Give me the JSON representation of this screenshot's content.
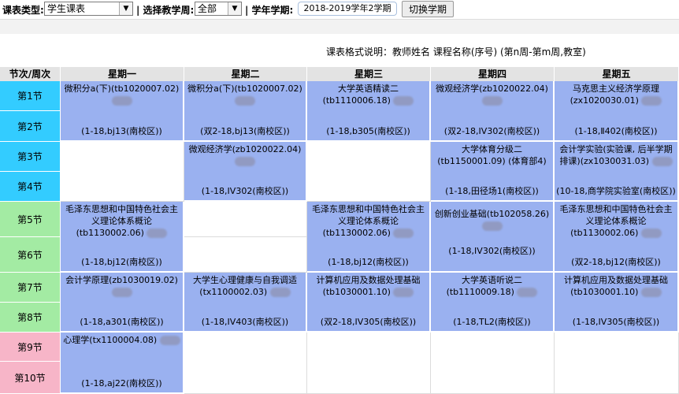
{
  "toolbar": {
    "type_label": "课表类型:",
    "type_value": "学生课表",
    "week_label": "| 选择教学周:",
    "week_value": "全部",
    "term_label": "|  学年学期:",
    "term_value": "2018-2019学年2学期",
    "switch_button": "切换学期"
  },
  "legend": "课表格式说明：教师姓名 课程名称(序号) (第n周-第m周,教室)",
  "header": {
    "corner": "节次/周次",
    "days": [
      "星期一",
      "星期二",
      "星期三",
      "星期四",
      "星期五"
    ]
  },
  "periods": [
    "第1节",
    "第2节",
    "第3节",
    "第4节",
    "第5节",
    "第6节",
    "第7节",
    "第8节",
    "第9节",
    "第10节"
  ],
  "colors": {
    "course_bg": "#9ab1f0",
    "period_cyan": "#33ccff",
    "period_green": "#a3eba3",
    "period_pink": "#f7b5c8",
    "header_bg": "#e3e3e3"
  },
  "courses": [
    {
      "title": "微积分a(下)(tb1020007.02)",
      "weeks": "(1-18,bj13(南校区))"
    },
    {
      "title": "微积分a(下)(tb1020007.02)",
      "weeks": "(双2-18,bj13(南校区))"
    },
    {
      "title": "大学英语精读二(tb1110006.18)",
      "weeks": "(1-18,b305(南校区))"
    },
    {
      "title": "微观经济学(zb1020022.04)",
      "weeks": "(双2-18,IV302(南校区))"
    },
    {
      "title": "马克思主义经济学原理(zx1020030.01)",
      "weeks": "(1-18,Ⅱ402(南校区))"
    },
    {
      "title": "微观经济学(zb1020022.04)",
      "weeks": "(1-18,IV302(南校区))"
    },
    {
      "title": "大学体育分级二(tb1150001.09) (体育部4)",
      "weeks": "(1-18,田径场1(南校区))"
    },
    {
      "title": "会计学实验(实验课, 后半学期排课)(zx1030031.03)",
      "weeks": "(10-18,商学院实验室(南校区))"
    },
    {
      "title": "毛泽东思想和中国特色社会主义理论体系概论(tb1130002.06)",
      "weeks": "(1-18,bj12(南校区))"
    },
    {
      "title": "毛泽东思想和中国特色社会主义理论体系概论(tb1130002.06)",
      "weeks": "(1-18,bj12(南校区))"
    },
    {
      "title": "创新创业基础(tb102058.26)",
      "weeks": "(1-18,IV302(南校区))"
    },
    {
      "title": "毛泽东思想和中国特色社会主义理论体系概论(tb1130002.06)",
      "weeks": "(双2-18,bj12(南校区))"
    },
    {
      "title": "会计学原理(zb1030019.02)",
      "weeks": "(1-18,a301(南校区))"
    },
    {
      "title": "大学生心理健康与自我调适(tx1100002.03)",
      "weeks": "(1-18,IV403(南校区))"
    },
    {
      "title": "计算机应用及数据处理基础(tb1030001.10)",
      "weeks": "(双2-18,IV305(南校区))"
    },
    {
      "title": "大学英语听说二(tb1110009.18)",
      "weeks": "(1-18,TL2(南校区))"
    },
    {
      "title": "计算机应用及数据处理基础(tb1030001.10)",
      "weeks": "(1-18,IV305(南校区))"
    },
    {
      "title": "心理学(tx1100004.08)",
      "weeks": "(1-18,aj22(南校区))"
    }
  ]
}
